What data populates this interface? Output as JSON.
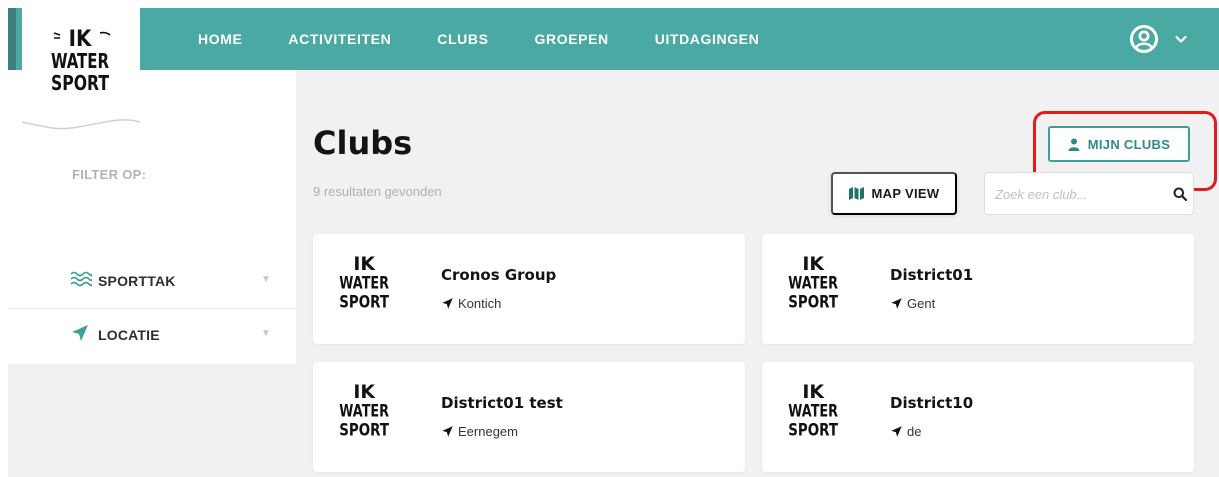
{
  "brand": {
    "logo_lines": [
      "IK",
      "WATER",
      "SPORT"
    ]
  },
  "nav": {
    "items": [
      "HOME",
      "ACTIVITEITEN",
      "CLUBS",
      "GROEPEN",
      "UITDAGINGEN"
    ]
  },
  "header": {
    "user_icon": "user-circle-icon",
    "menu_icon": "chevron-down-icon"
  },
  "sidebar": {
    "filter_label": "FILTER OP:",
    "filters": [
      {
        "label": "SPORTTAK",
        "icon": "waves-icon"
      },
      {
        "label": "LOCATIE",
        "icon": "location-arrow-icon"
      }
    ]
  },
  "main": {
    "title": "Clubs",
    "results": "9 resultaten gevonden",
    "mijn_clubs_label": "MIJN CLUBS",
    "map_view_label": "MAP VIEW",
    "search_placeholder": "Zoek een club...",
    "clubs": [
      {
        "name": "Cronos Group",
        "location": "Kontich"
      },
      {
        "name": "District01",
        "location": "Gent"
      },
      {
        "name": "District01 test",
        "location": "Eernegem"
      },
      {
        "name": "District10",
        "location": "de"
      }
    ]
  },
  "colors": {
    "primary": "#4aa9a3",
    "accent_text": "#2f8b86",
    "highlight": "#e51b1b",
    "background": "#f1f1f1"
  }
}
